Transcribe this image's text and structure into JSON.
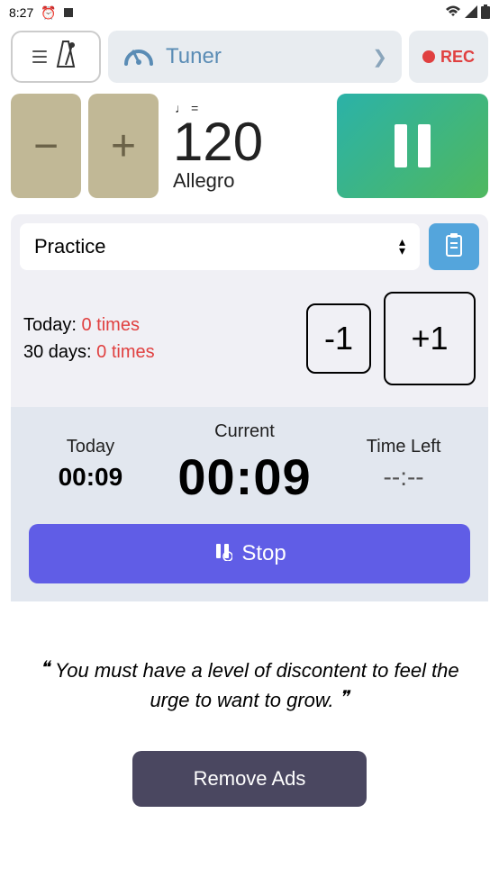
{
  "status": {
    "time": "8:27"
  },
  "top": {
    "tuner_label": "Tuner",
    "rec_label": "REC"
  },
  "tempo": {
    "minus": "−",
    "plus": "+",
    "note_label": "♩ =",
    "bpm": "120",
    "name": "Allegro"
  },
  "practice": {
    "select_label": "Practice",
    "today_label": "Today:",
    "today_value": "0 times",
    "days_label": "30 days:",
    "days_value": "0 times",
    "minus": "-1",
    "plus": "+1"
  },
  "timer": {
    "today_label": "Today",
    "today_val": "00:09",
    "current_label": "Current",
    "current_val": "00:09",
    "left_label": "Time Left",
    "left_val": "--:--",
    "stop_label": "Stop"
  },
  "quote": {
    "text": "You must have a level of discontent to feel the urge to want to grow."
  },
  "ads": {
    "remove_label": "Remove Ads"
  }
}
